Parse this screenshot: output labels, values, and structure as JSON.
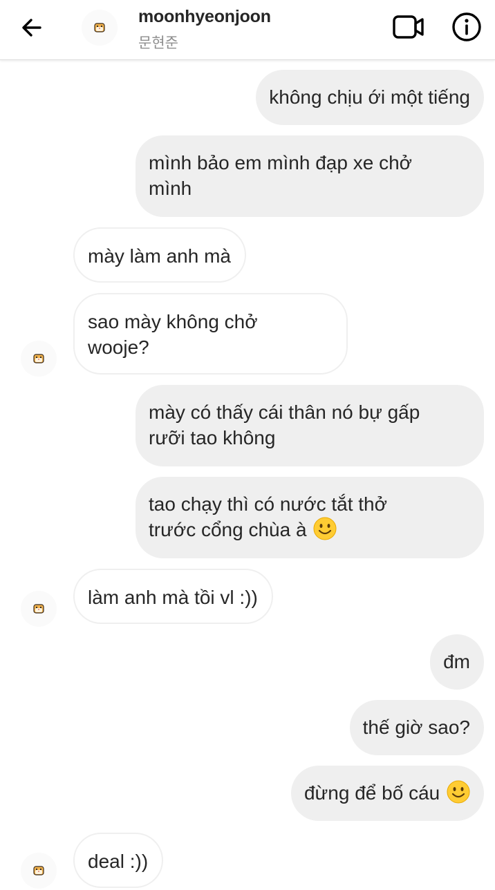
{
  "header": {
    "username": "moonhyeonjoon",
    "subtitle": "문현준"
  },
  "icons": {
    "back": "arrow-left-icon",
    "video": "video-camera-icon",
    "info": "info-circle-icon",
    "avatar": "hamster-avatar",
    "emoji": "slightly-smiling-face-emoji"
  },
  "colors": {
    "outgoing_bubble": "#efefef",
    "incoming_border": "#efefef",
    "emoji_yellow": "#ffcc33"
  },
  "messages": [
    {
      "side": "out",
      "text": "không chịu ới một tiếng"
    },
    {
      "side": "out",
      "text": "mình bảo em mình đạp xe chở\nmình"
    },
    {
      "side": "in",
      "text": "mày làm anh mà"
    },
    {
      "side": "in",
      "text": "sao mày không chở\nwooje?"
    },
    {
      "side": "out",
      "text": "mày có thấy cái thân nó bự gấp\nrưỡi tao không"
    },
    {
      "side": "out",
      "text": "tao chạy thì có nước tắt thở\ntrước cổng chùa à "
    },
    {
      "side": "in",
      "text": "làm anh mà tồi vl :))"
    },
    {
      "side": "out",
      "text": "đm"
    },
    {
      "side": "out",
      "text": "thế giờ sao?"
    },
    {
      "side": "out",
      "text": "đừng để bố cáu "
    },
    {
      "side": "in",
      "text": "deal :))"
    }
  ]
}
